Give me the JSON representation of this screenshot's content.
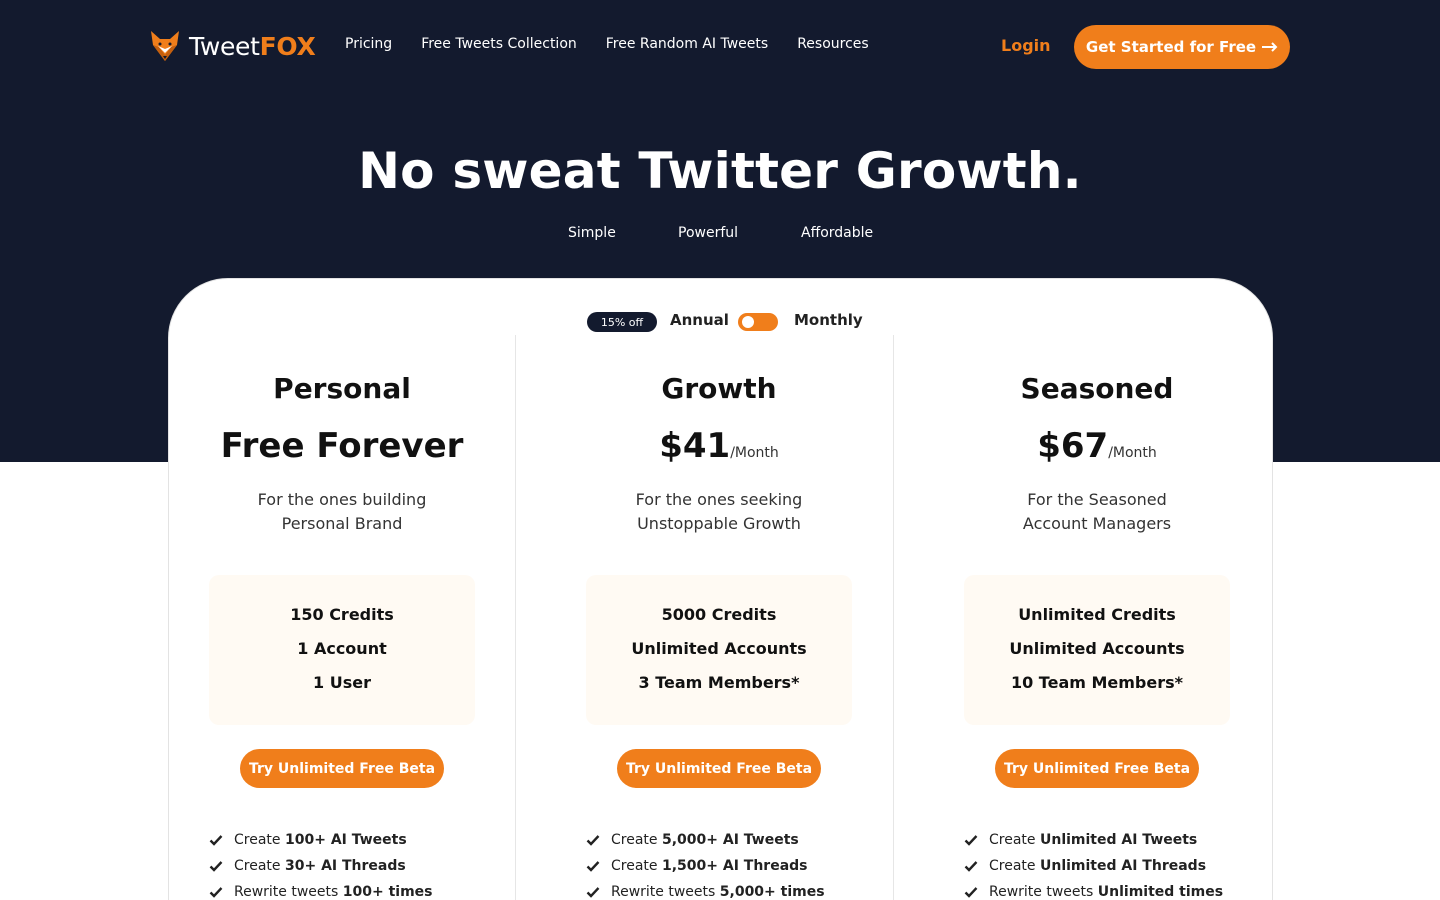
{
  "brand": {
    "name_light": "Tweet",
    "name_bold": "FOX",
    "accent": "#f07e1b",
    "dark_bg": "#131a2e",
    "logo_icon": "fox-icon"
  },
  "nav": {
    "links": [
      "Pricing",
      "Free Tweets Collection",
      "Free Random AI Tweets",
      "Resources"
    ],
    "login": "Login",
    "cta": "Get Started for Free",
    "cta_icon": "arrow-right-icon"
  },
  "hero": {
    "title": "No sweat Twitter Growth.",
    "taglines": [
      "Simple",
      "Powerful",
      "Affordable"
    ]
  },
  "billing": {
    "discount_badge": "15% off",
    "annual_label": "Annual",
    "monthly_label": "Monthly",
    "selected": "Monthly"
  },
  "plans": [
    {
      "name": "Personal",
      "price": "Free Forever",
      "price_unit": "",
      "desc_lines": [
        "For the ones building",
        "Personal Brand"
      ],
      "credits": [
        "150 Credits",
        "1 Account",
        "1 User"
      ],
      "button": "Try Unlimited Free Beta",
      "features": [
        {
          "pre": "Create ",
          "bold": "100+ AI Tweets"
        },
        {
          "pre": "Create ",
          "bold": "30+ AI Threads"
        },
        {
          "pre": "Rewrite tweets ",
          "bold": "100+ times"
        }
      ]
    },
    {
      "name": "Growth",
      "price": "$41",
      "price_unit": "/Month",
      "desc_lines": [
        "For the ones seeking",
        "Unstoppable Growth"
      ],
      "credits": [
        "5000 Credits",
        "Unlimited Accounts",
        "3 Team Members*"
      ],
      "button": "Try Unlimited Free Beta",
      "features": [
        {
          "pre": "Create ",
          "bold": "5,000+ AI Tweets"
        },
        {
          "pre": "Create ",
          "bold": "1,500+ AI Threads"
        },
        {
          "pre": "Rewrite tweets ",
          "bold": "5,000+ times"
        }
      ]
    },
    {
      "name": "Seasoned",
      "price": "$67",
      "price_unit": "/Month",
      "desc_lines": [
        "For the Seasoned",
        "Account Managers"
      ],
      "credits": [
        "Unlimited Credits",
        "Unlimited Accounts",
        "10 Team Members*"
      ],
      "button": "Try Unlimited Free Beta",
      "features": [
        {
          "pre": "Create ",
          "bold": "Unlimited AI Tweets"
        },
        {
          "pre": "Create ",
          "bold": "Unlimited AI Threads"
        },
        {
          "pre": "Rewrite tweets ",
          "bold": "Unlimited times"
        }
      ]
    }
  ]
}
